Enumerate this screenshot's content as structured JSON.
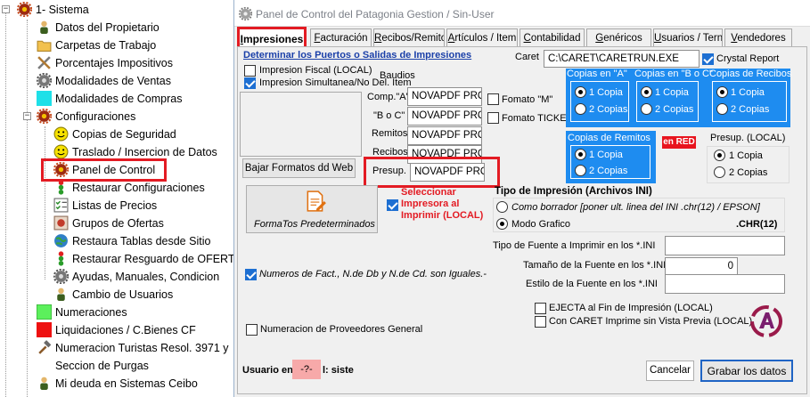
{
  "tree": {
    "root_label": "1- Sistema",
    "items": [
      {
        "label": "Datos del Propietario",
        "icon": "person-icon"
      },
      {
        "label": "Carpetas de Trabajo",
        "icon": "folder-icon"
      },
      {
        "label": "Porcentajes Impositivos",
        "icon": "tools-icon"
      },
      {
        "label": "Modalidades de Ventas",
        "icon": "gear-icon"
      },
      {
        "label": "Modalidades de Compras",
        "icon": "cyan-square-icon"
      },
      {
        "label": "Configuraciones",
        "icon": "gear-red-icon"
      },
      {
        "label": "Copias de Seguridad",
        "icon": "smiley-icon"
      },
      {
        "label": "Traslado / Insercion de Datos",
        "icon": "smiley-icon"
      },
      {
        "label": "Panel de Control",
        "icon": "gear-red-icon"
      },
      {
        "label": "Restaurar Configuraciones",
        "icon": "traffic-light-icon"
      },
      {
        "label": "Listas de Precios",
        "icon": "checklist-icon"
      },
      {
        "label": "Grupos de Ofertas",
        "icon": "ofertas-icon"
      },
      {
        "label": "Restaura Tablas desde Sitio",
        "icon": "globe-icon"
      },
      {
        "label": "Restaurar Resguardo de OFERT",
        "icon": "traffic-light-icon"
      },
      {
        "label": "Ayudas, Manuales, Condicion",
        "icon": "gear-icon"
      },
      {
        "label": "Cambio de Usuarios",
        "icon": "person-icon"
      },
      {
        "label": "Numeraciones",
        "icon": "green-square-icon"
      },
      {
        "label": "Liquidaciones / C.Bienes CF",
        "icon": "red-square-icon"
      },
      {
        "label": "Numeracion Turistas Resol. 3971 y",
        "icon": "hammer-icon"
      },
      {
        "label": "Seccion de Purgas",
        "icon": ""
      },
      {
        "label": "Mi deuda en Sistemas Ceibo",
        "icon": "person-icon"
      }
    ]
  },
  "dialog": {
    "title": "Panel de Control del Patagonia Gestion / Sin-User",
    "tabs": [
      {
        "label": "Impresiones",
        "underline": "I",
        "rest": "mpresiones"
      },
      {
        "label": "Facturación",
        "underline": "F",
        "rest": "acturación"
      },
      {
        "label": "Recibos/Remito",
        "underline": "R",
        "rest": "ecibos/Remito"
      },
      {
        "label": "Artículos / Item",
        "underline": "A",
        "rest": "rtículos / Item"
      },
      {
        "label": "Contabilidad",
        "underline": "C",
        "rest": "ontabilidad"
      },
      {
        "label": "Genéricos",
        "underline": "G",
        "rest": "enéricos"
      },
      {
        "label": "Usuarios / Tern",
        "underline": "U",
        "rest": "suarios / Tern"
      },
      {
        "label": "Vendedores",
        "underline": "V",
        "rest": "endedores"
      }
    ],
    "ports_heading": "Determinar los Puertos o Salidas de Impresiones",
    "impresion_fiscal": "Impresion  Fiscal (LOCAL)",
    "impresion_simultanea": "Impresion Simultanea/No Del. Item",
    "baudios": "Baudios",
    "printers": [
      {
        "label": "Comp.\"A\"",
        "value": "NOVAPDF PRO"
      },
      {
        "label": "\"B o C\"",
        "value": "NOVAPDF PRO"
      },
      {
        "label": "Remitos",
        "value": "NOVAPDF PRO"
      },
      {
        "label": "Recibos",
        "value": "NOVAPDF PRO"
      },
      {
        "label": "Presup.",
        "value": "NOVAPDF PRO"
      }
    ],
    "fomato_m": "Fomato \"M\"",
    "fomato_ticket": "Fomato TICKET",
    "bajar_formatos_btn": "Bajar Formatos dd Web",
    "formatos_predeterminados_btn": "FormaTos Predeterminados",
    "seleccionar_impresora": "Seleccionar Impresora al Imprimir (LOCAL)",
    "caret_label": "Caret",
    "caret_value": "C:\\CARET\\CARETRUN.EXE",
    "crystal_report": "Crystal Report",
    "copias_a": {
      "title": "Copias en \"A\"",
      "opt1": "1 Copia",
      "opt2": "2 Copias"
    },
    "copias_bc": {
      "title": "Copias en \"B o C\"",
      "opt1": "1 Copia",
      "opt2": "2 Copias"
    },
    "copias_recibos": {
      "title": "Copias de Recibos",
      "opt1": "1 Copia",
      "opt2": "2 Copias"
    },
    "copias_remitos": {
      "title": "Copias de Remitos",
      "opt1": "1 Copia",
      "opt2": "2 Copias"
    },
    "en_red": "en RED",
    "presup_local": {
      "title": "Presup. (LOCAL)",
      "opt1": "1 Copia",
      "opt2": "2 Copias"
    },
    "tipo_impresion_heading": "Tipo de Impresión (Archivos INI)",
    "como_borrador": "Como borrador [poner ult. linea del INI .chr(12) / EPSON]",
    "modo_grafico": "Modo Grafico",
    "chr12": ".CHR(12)",
    "tipo_fuente_label": "Tipo de Fuente a Imprimir en los *.INI",
    "tipo_fuente_value": "",
    "tamano_fuente_label": "Tamaño de la Fuente en los *.INI",
    "tamano_fuente_value": "0",
    "estilo_fuente_label": "Estilo de la Fuente en los *.INI",
    "estilo_fuente_value": "",
    "numeros_iguales": "Numeros de Fact., N.de Db y N.de Cd. son Iguales.-",
    "ejecuta_fin": "EJECTA al Fin de Impresión (LOCAL)",
    "con_caret": "Con CARET Imprime sin Vista Previa (LOCAL)",
    "numeracion_proveedores": "Numeracion de Proveedores General",
    "usuario_prefix": "Usuario en",
    "usuario_value": "-?-",
    "usuario_suffix": "l: siste",
    "cancelar_btn": "Cancelar",
    "grabar_btn": "Grabar los datos",
    "colors": {
      "accent_red": "#e31b23",
      "copias_blue": "#1e8cf0",
      "en_red_bg": "#e8141e",
      "link_blue": "#1a3fa8"
    }
  }
}
